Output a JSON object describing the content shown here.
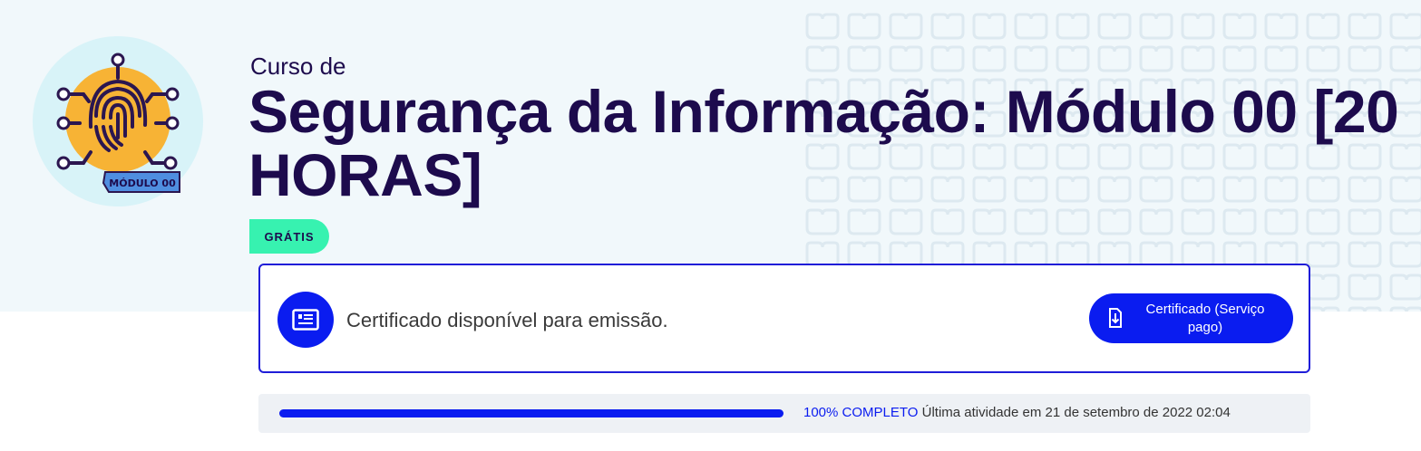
{
  "course": {
    "eyebrow": "Curso de",
    "title": "Segurança da Informação: Módulo 00 [20 HORAS]",
    "badge": "GRÁTIS",
    "logo_label": "MÓDULO 00"
  },
  "certificate": {
    "icon": "certificate-icon",
    "message": "Certificado disponível para emissão.",
    "button_label": "Certificado (Serviço pago)",
    "button_icon": "download-document-icon"
  },
  "progress": {
    "value": 1.0,
    "percent_label": "100% COMPLETO",
    "last_activity": "Última atividade em 21 de setembro de 2022 02:04"
  },
  "colors": {
    "primary": "#0a1cf0",
    "heading": "#1d0b4d",
    "badge": "#37f2b0",
    "hero_bg": "#f1f8fb"
  }
}
